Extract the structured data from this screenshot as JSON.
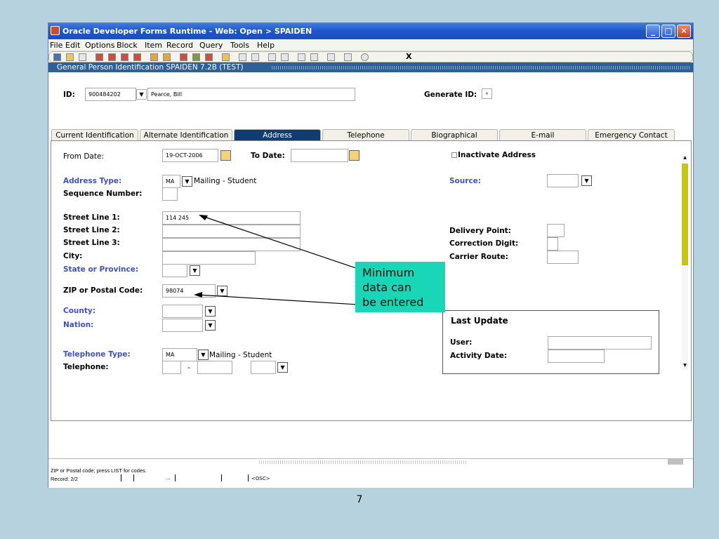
{
  "window": {
    "title": "Oracle Developer Forms Runtime - Web:  Open > SPAIDEN",
    "minimize": "_",
    "maximize": "□",
    "close": "✕"
  },
  "menu": [
    "File",
    "Edit",
    "Options",
    "Block",
    "Item",
    "Record",
    "Query",
    "Tools",
    "Help"
  ],
  "toolbar": {
    "exit_label": "X"
  },
  "form": {
    "title": "General Person Identification  SPAIDEN  7.2B  (TEST)"
  },
  "key": {
    "id_label": "ID:",
    "id_value": "900484202",
    "name_value": "Pearce, Bill",
    "generate_label": "Generate ID:"
  },
  "tabs": [
    "Current Identification",
    "Alternate Identification",
    "Address",
    "Telephone",
    "Biographical",
    "E-mail",
    "Emergency Contact"
  ],
  "address": {
    "from_date_label": "From Date:",
    "from_date_value": "19-OCT-2006",
    "to_date_label": "To Date:",
    "inactivate_label": "Inactivate Address",
    "address_type_label": "Address Type:",
    "address_type_code": "MA",
    "address_type_desc": "Mailing - Student",
    "sequence_label": "Sequence Number:",
    "source_label": "Source:",
    "street1_label": "Street Line 1:",
    "street1_value": "114 245",
    "street2_label": "Street Line 2:",
    "street3_label": "Street Line 3:",
    "city_label": "City:",
    "state_label": "State or Province:",
    "zip_label": "ZIP or Postal Code:",
    "zip_value": "98074",
    "county_label": "County:",
    "nation_label": "Nation:",
    "delivery_label": "Delivery Point:",
    "correction_label": "Correction Digit:",
    "carrier_label": "Carrier Route:",
    "tel_type_label": "Telephone Type:",
    "tel_type_code": "MA",
    "tel_type_desc": "Mailing - Student",
    "telephone_label": "Telephone:",
    "tel_dash": "-"
  },
  "last_update": {
    "title": "Last Update",
    "user_label": "User:",
    "activity_label": "Activity Date:"
  },
  "callout": {
    "line1": "Minimum",
    "line2": "data can",
    "line3": "be entered"
  },
  "status": {
    "hint": "ZIP or Postal code; press LIST for codes.",
    "record": "Record: 2/2",
    "ellipsis": "...",
    "osc": "<OSC>"
  },
  "page_number": "7"
}
